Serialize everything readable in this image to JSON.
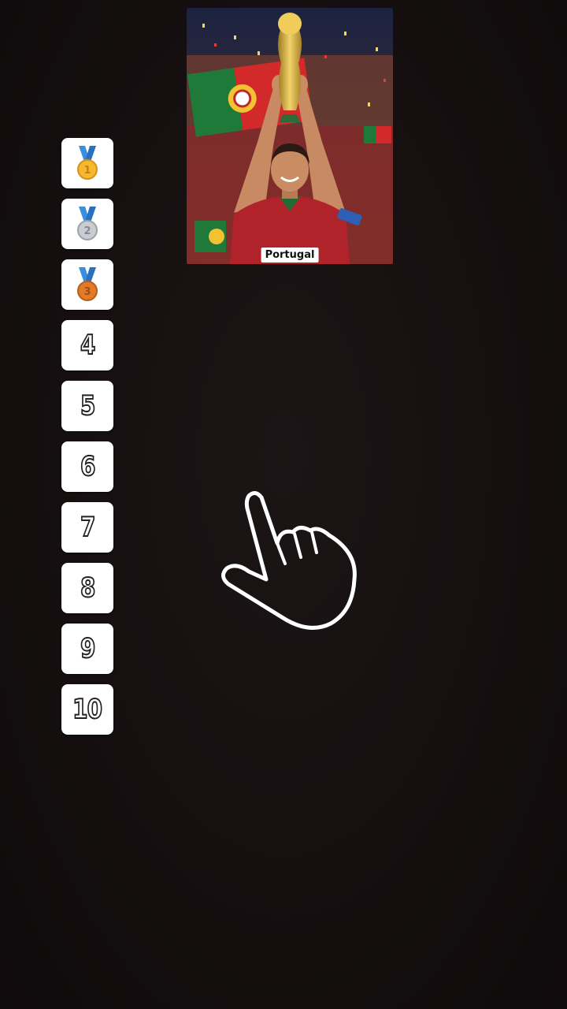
{
  "card": {
    "label": "Portugal",
    "icon": "player-photo"
  },
  "ranks": [
    {
      "slot": "1",
      "icon": "gold-medal-icon"
    },
    {
      "slot": "2",
      "icon": "silver-medal-icon"
    },
    {
      "slot": "3",
      "icon": "bronze-medal-icon"
    },
    {
      "slot": "4"
    },
    {
      "slot": "5"
    },
    {
      "slot": "6"
    },
    {
      "slot": "7"
    },
    {
      "slot": "8"
    },
    {
      "slot": "9"
    },
    {
      "slot": "10"
    }
  ],
  "colors": {
    "background": "#140e0f",
    "slot": "#ffffff",
    "gold": "#f5b82e",
    "silver": "#c9ccd1",
    "bronze": "#e07b2a",
    "ribbon": "#3a8ee0"
  },
  "pointer": {
    "icon": "tap-hand-icon"
  }
}
